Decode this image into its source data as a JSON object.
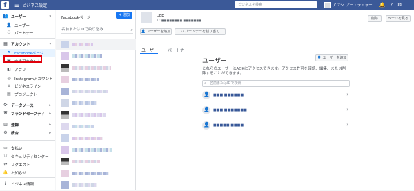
{
  "topbar": {
    "logo": "f",
    "menu_icon": "☰",
    "title": "ビジネス設定",
    "search_placeholder": "ビジネスを検索",
    "user_name": "アツシ",
    "user_extra": "アー・ラ・ャー",
    "icons": [
      "bell-icon",
      "help-icon",
      "gear-icon"
    ]
  },
  "sidebar": {
    "items": [
      {
        "label": "ユーザー",
        "icon": "👥",
        "kind": "section",
        "arrow": "▾"
      },
      {
        "label": "ユーザー",
        "icon": "👤",
        "kind": "sub"
      },
      {
        "label": "パートナー",
        "icon": "⚇",
        "kind": "sub"
      },
      {
        "label": "アカウント",
        "icon": "▦",
        "kind": "section",
        "arrow": "▾"
      },
      {
        "label": "Facebookページ",
        "icon": "⚑",
        "kind": "sub",
        "active": true
      },
      {
        "label": "広告アカウント",
        "icon": "▣",
        "kind": "sub"
      },
      {
        "label": "アプリ",
        "icon": "◧",
        "kind": "sub"
      },
      {
        "label": "Instagramアカウント",
        "icon": "◎",
        "kind": "sub"
      },
      {
        "label": "ビジネスライン",
        "icon": "≡",
        "kind": "sub"
      },
      {
        "label": "プロジェクト",
        "icon": "▤",
        "kind": "sub"
      },
      {
        "label": "データソース",
        "icon": "⟳",
        "kind": "section",
        "arrow": "▸"
      },
      {
        "label": "ブランドセーフティ",
        "icon": "⛨",
        "kind": "section",
        "arrow": "▸"
      },
      {
        "label": "登録",
        "icon": "▥",
        "kind": "section",
        "arrow": "▸"
      },
      {
        "label": "統合",
        "icon": "⚙",
        "kind": "section",
        "arrow": "▸"
      },
      {
        "label": "支払い",
        "icon": "▭",
        "kind": "plain"
      },
      {
        "label": "セキュリティセンター",
        "icon": "⛉",
        "kind": "plain"
      },
      {
        "label": "リクエスト",
        "icon": "⇄",
        "kind": "plain"
      },
      {
        "label": "お知らせ",
        "icon": "🔔",
        "kind": "plain"
      },
      {
        "label": "ビジネス情報",
        "icon": "ℹ",
        "kind": "plain"
      }
    ]
  },
  "pagelist": {
    "header": "Facebookページ",
    "add_label": "+ 追加",
    "search_placeholder": "名前またはIDで絞り込み",
    "rows": 13
  },
  "detail": {
    "page_title": "DBE",
    "page_id": "ID: ■■■■■■■■ ■■■■■■■",
    "delete_label": "削除",
    "view_page_label": "ページを見る",
    "add_user_label": "ユーザーを追加",
    "assign_partner_label": "パートナーを割り当て",
    "tabs": [
      "ユーザー",
      "パートナー"
    ],
    "users_title": "ユーザー",
    "add_user_btn": "ユーザーを追加",
    "users_desc": "これらのユーザーはADKにアクセスできます。アクセス許可を確認、編集、または削除することができます。",
    "search_placeholder": "名前またはIDで検索",
    "users": [
      {
        "name": "■■■ ■■■■■■",
        "icon": "👤"
      },
      {
        "name": "■■■ ■■■■■■■",
        "icon": "👤"
      },
      {
        "name": "■■■■■ ■■■■",
        "icon": "👤"
      }
    ]
  }
}
